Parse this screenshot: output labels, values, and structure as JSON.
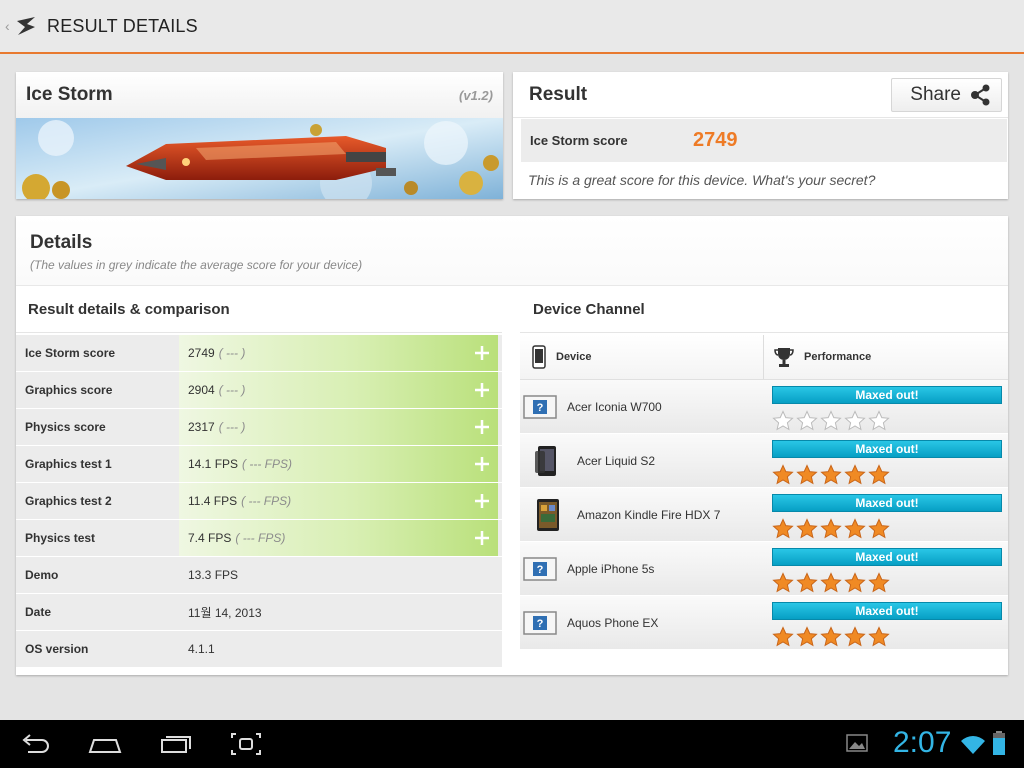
{
  "topbar": {
    "title": "RESULT DETAILS",
    "back_icon": "chevron-left-icon",
    "logo_icon": "3dmark-logo-icon"
  },
  "ice_storm": {
    "title": "Ice Storm",
    "version": "(v1.2)"
  },
  "result": {
    "title": "Result",
    "share_label": "Share",
    "score_label": "Ice Storm score",
    "score_value": "2749",
    "message": "This is a great score for this device. What's your secret?"
  },
  "details": {
    "title": "Details",
    "subtitle": "(The values in grey indicate the average score for your device)",
    "comparison_title": "Result details & comparison",
    "rows": [
      {
        "label": "Ice Storm score",
        "value": "2749",
        "avg": "( --- )",
        "expandable": true
      },
      {
        "label": "Graphics score",
        "value": "2904",
        "avg": "( --- )",
        "expandable": true
      },
      {
        "label": "Physics score",
        "value": "2317",
        "avg": "( --- )",
        "expandable": true
      },
      {
        "label": "Graphics test 1",
        "value": "14.1 FPS",
        "avg": "( --- FPS)",
        "expandable": true
      },
      {
        "label": "Graphics test 2",
        "value": "11.4 FPS",
        "avg": "( --- FPS)",
        "expandable": true
      },
      {
        "label": "Physics test",
        "value": "7.4 FPS",
        "avg": "( --- FPS)",
        "expandable": true
      },
      {
        "label": "Demo",
        "value": "13.3 FPS",
        "avg": "",
        "expandable": false
      },
      {
        "label": "Date",
        "value": "11월 14, 2013",
        "avg": "",
        "expandable": false
      },
      {
        "label": "OS version",
        "value": "4.1.1",
        "avg": "",
        "expandable": false
      }
    ]
  },
  "device_channel": {
    "title": "Device Channel",
    "col_device": "Device",
    "col_performance": "Performance",
    "devices": [
      {
        "name": "Acer Iconia W700",
        "badge": "Maxed out!",
        "stars": 0,
        "thumb": "unknown-device-icon"
      },
      {
        "name": "Acer Liquid S2",
        "badge": "Maxed out!",
        "stars": 5,
        "thumb": "phone-icon"
      },
      {
        "name": "Amazon Kindle Fire HDX 7",
        "badge": "Maxed out!",
        "stars": 5,
        "thumb": "tablet-icon"
      },
      {
        "name": "Apple iPhone 5s",
        "badge": "Maxed out!",
        "stars": 5,
        "thumb": "unknown-device-icon"
      },
      {
        "name": "Aquos Phone EX",
        "badge": "Maxed out!",
        "stars": 5,
        "thumb": "unknown-device-icon"
      }
    ]
  },
  "navbar": {
    "time": "2:07"
  },
  "colors": {
    "accent": "#e8792f",
    "score": "#ee7b26",
    "badge": "#0ea9cf",
    "star": "#f08a24",
    "clock": "#33b5e5"
  }
}
